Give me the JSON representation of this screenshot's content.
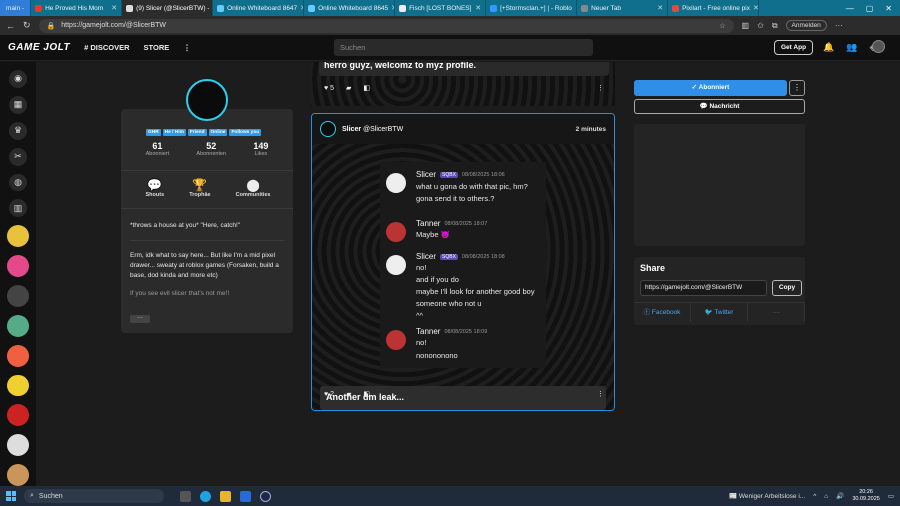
{
  "browser": {
    "tabs": [
      {
        "label": "main -",
        "group": true
      },
      {
        "label": "He Proved His Mom"
      },
      {
        "label": "(9) Slicer (@SlicerBTW) -",
        "active": true
      },
      {
        "label": "Online Whiteboard 8647"
      },
      {
        "label": "Online Whiteboard 8645"
      },
      {
        "label": "Fisch [LOST BONES]"
      },
      {
        "label": "[+Stormsclan.+] | - Roblo"
      },
      {
        "label": "Neuer Tab"
      },
      {
        "label": "Pixilart - Free online pix"
      }
    ],
    "url": "https://gamejolt.com/@SlicerBTW",
    "signin": "Anmelden"
  },
  "gj": {
    "logo": "GAME JOLT",
    "discover": "DISCOVER",
    "store": "STORE",
    "search_placeholder": "Suchen",
    "get_app": "Get App"
  },
  "profile": {
    "tags": [
      "GHR",
      "He / Him",
      "Friend",
      "Online",
      "Follows you"
    ],
    "stats": [
      {
        "value": "61",
        "label": "Abonniert"
      },
      {
        "value": "52",
        "label": "Abonnenten"
      },
      {
        "value": "149",
        "label": "Likes"
      }
    ],
    "actions": [
      "Shouts",
      "Trophäe",
      "Communities"
    ],
    "tagline": "*throws a house at you* \"Here, catch!\"",
    "bio": "Erm, idk what to say here... But like I'm a mid pixel drawer... sweaty at roblox games (Forsaken, build a base, dod kinda and more etc)",
    "bio2": "If you see evil slicer that's not me!!",
    "more": "···"
  },
  "post1": {
    "title": "herro guyz, welcomz to myz profile.",
    "likes": "5"
  },
  "post2": {
    "author": "Slicer",
    "handle": "@SlicerBTW",
    "time": "2 minutes",
    "caption": "Another dm leak...",
    "likes": "2",
    "messages": [
      {
        "name": "Slicer",
        "badge": "SQBX",
        "time": "08/08/2025 18:06",
        "lines": [
          "what u gona do with that pic, hm?",
          "gona send it to others.?"
        ]
      },
      {
        "name": "Tanner",
        "time": "08/08/2025 18:07",
        "lines": [
          "Maybe 😈"
        ]
      },
      {
        "name": "Slicer",
        "badge": "SQBX",
        "time": "08/08/2025 18:08",
        "lines": [
          "no!",
          "and if you do",
          "maybe I'll look for another good boy",
          "someone who not u",
          "^^"
        ]
      },
      {
        "name": "Tanner",
        "time": "08/08/2025 18:09",
        "lines": [
          "no!",
          "nonononono"
        ]
      }
    ]
  },
  "sidepanel": {
    "follow": "Abonniert",
    "message": "Nachricht",
    "share_title": "Share",
    "share_url": "https://gamejolt.com/@SlicerBTW",
    "copy": "Copy",
    "facebook": "Facebook",
    "twitter": "Twitter",
    "more": "···"
  },
  "taskbar": {
    "search": "Suchen",
    "weather": "Weniger Arbeitslose i...",
    "time": "20:26",
    "date": "30.09.2025"
  }
}
